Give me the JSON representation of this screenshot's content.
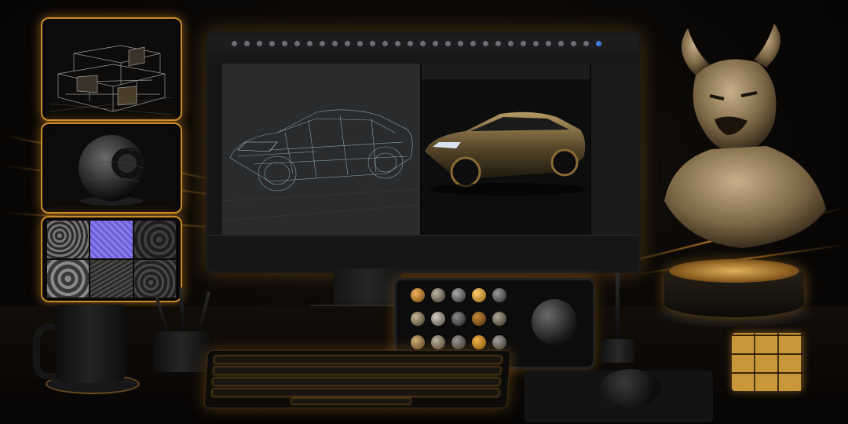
{
  "scene": {
    "title": "",
    "accent_color": "#e39a2c",
    "background_color": "#080605"
  },
  "side_panels": [
    {
      "subject": "wireframe-house",
      "icon": "house-icon"
    },
    {
      "subject": "material-ball",
      "icon": "sphere-icon"
    },
    {
      "subject": "texture-maps",
      "icon": "texture-grid-icon"
    }
  ],
  "monitor": {
    "viewport_left": {
      "subject": "wireframe-sports-car"
    },
    "viewport_right": {
      "subject": "rendered-gold-sports-car"
    }
  },
  "tablet": {
    "material_spheres": [
      "bronze",
      "stone",
      "stone",
      "gold",
      "stone",
      "stone",
      "stone",
      "stone",
      "bronze",
      "stone",
      "stone",
      "stone",
      "stone",
      "gold",
      "stone"
    ]
  },
  "sculpture": {
    "subject": "horned-demon-bust"
  },
  "desk_items": [
    "mug",
    "pencil-cup",
    "keyboard",
    "mouse",
    "stylus",
    "rubiks-cube"
  ]
}
